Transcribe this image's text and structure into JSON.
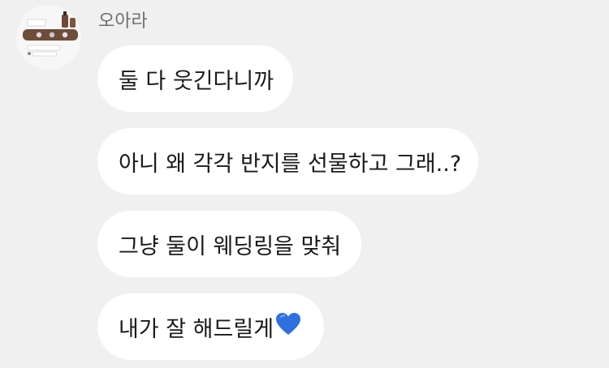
{
  "chat": {
    "sender_name": "오아라",
    "avatar": {
      "icon": "jewelry-tray-photo-avatar"
    },
    "messages": [
      {
        "text": "둘 다 웃긴다니까"
      },
      {
        "text": "아니 왜 각각 반지를 선물하고 그래..?"
      },
      {
        "text": "그냥 둘이 웨딩링을 맞춰"
      },
      {
        "text": "내가 잘 해드릴게",
        "emoji": "blue-heart-icon"
      }
    ]
  },
  "colors": {
    "background": "#f0f0f0",
    "bubble": "#ffffff",
    "text": "#1a1a1a",
    "sender": "#6e6e6e",
    "heart": "#2f6fe0"
  }
}
